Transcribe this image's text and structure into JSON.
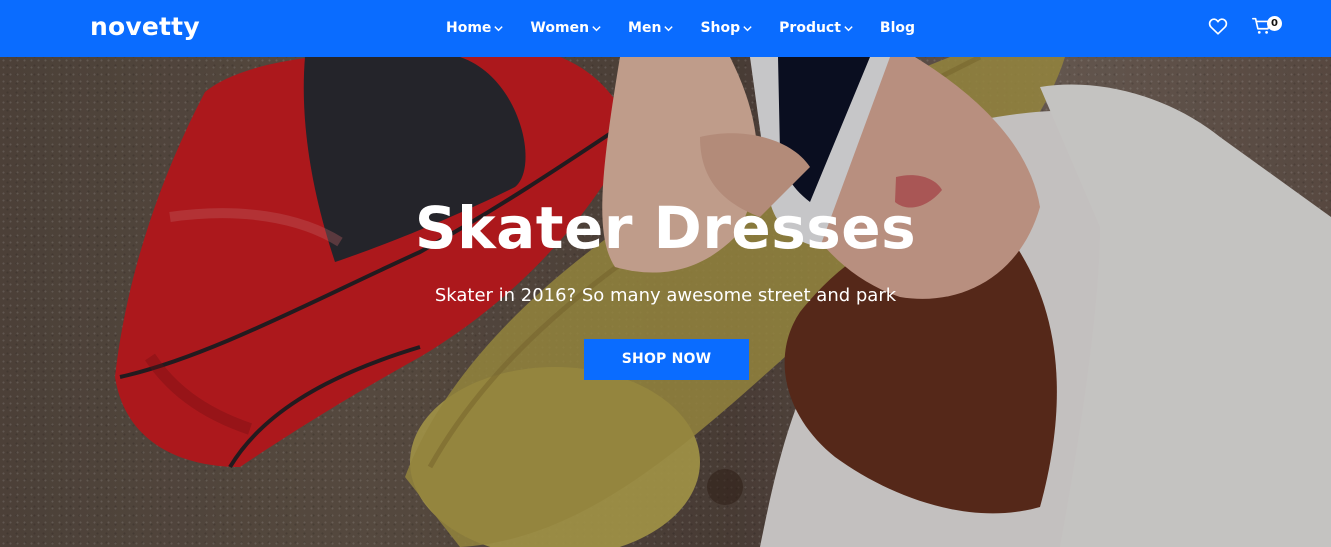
{
  "header": {
    "logo": "novetty",
    "nav": [
      {
        "label": "Home",
        "icon": "chevron-down-icon"
      },
      {
        "label": "Women",
        "icon": "chevron-down-icon"
      },
      {
        "label": "Men",
        "icon": "chevron-down-icon"
      },
      {
        "label": "Shop",
        "icon": "chevron-down-icon"
      },
      {
        "label": "Product",
        "icon": "chevron-down-icon"
      },
      {
        "label": "Blog"
      }
    ],
    "icons": {
      "wishlist": "heart-icon",
      "cart": "cart-icon"
    },
    "cart_count": "0"
  },
  "hero": {
    "title": "Skater Dresses",
    "subtitle": "Skater in 2016? So many awesome street and park",
    "cta": "SHOP NOW"
  },
  "colors": {
    "brand_blue": "#0a6cff",
    "text_white": "#ffffff",
    "hero_ground": "#5f5147",
    "bag_red": "#d71f24",
    "skateboard_gold": "#c6b458",
    "shirt_white": "#f4f1ef",
    "hair_brown": "#6b3320"
  }
}
